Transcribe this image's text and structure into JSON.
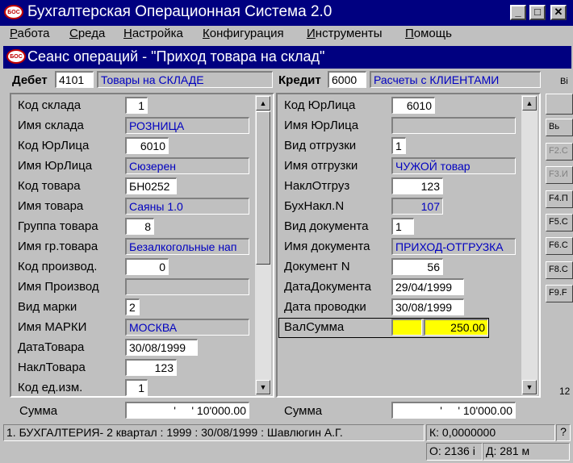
{
  "window": {
    "title": "Бухгалтерская Операционная Система 2.0",
    "controls": {
      "minimize": "_",
      "maximize": "□",
      "close": "✕"
    }
  },
  "menu": [
    "Работа",
    "Среда",
    "Настройка",
    "Конфигурация",
    "Инструменты",
    "Помощь"
  ],
  "session": {
    "title": "Сеанс операций - \"Приход товара на склад\""
  },
  "debit": {
    "label": "Дебет",
    "code": "4101",
    "name": "Товары на СКЛАДЕ"
  },
  "credit": {
    "label": "Кредит",
    "code": "6000",
    "name": "Расчеты с КЛИЕНТАМИ"
  },
  "left_fields": [
    {
      "label": "Код склада",
      "value": "1",
      "kind": "white"
    },
    {
      "label": "Имя склада",
      "value": "РОЗНИЦА",
      "kind": "blue"
    },
    {
      "label": "Код ЮрЛица",
      "value": "6010",
      "kind": "white"
    },
    {
      "label": "Имя ЮрЛица",
      "value": "Сюзерен",
      "kind": "blue"
    },
    {
      "label": "Код товара",
      "value": "БН0252",
      "kind": "white"
    },
    {
      "label": "Имя товара",
      "value": "Саяны 1.0",
      "kind": "blue"
    },
    {
      "label": "Группа товара",
      "value": "8",
      "kind": "white"
    },
    {
      "label": "Имя гр.товара",
      "value": "Безалкогольные нап",
      "kind": "blue"
    },
    {
      "label": "Код производ.",
      "value": "0",
      "kind": "white"
    },
    {
      "label": "Имя Производ",
      "value": "",
      "kind": "blue"
    },
    {
      "label": "Вид марки",
      "value": "2",
      "kind": "white"
    },
    {
      "label": "Имя МАРКИ",
      "value": "МОСКВА",
      "kind": "blue"
    },
    {
      "label": "ДатаТовара",
      "value": "30/08/1999",
      "kind": "white"
    },
    {
      "label": "НаклТовара",
      "value": "123",
      "kind": "white"
    },
    {
      "label": "Код ед.изм.",
      "value": "1",
      "kind": "white"
    }
  ],
  "right_fields": [
    {
      "label": "Код ЮрЛица",
      "value": "6010",
      "kind": "white"
    },
    {
      "label": "Имя ЮрЛица",
      "value": "",
      "kind": "blue"
    },
    {
      "label": "Вид отгрузки",
      "value": "1",
      "kind": "white"
    },
    {
      "label": "Имя отгрузки",
      "value": "ЧУЖОЙ товар",
      "kind": "blue"
    },
    {
      "label": "НаклОтгруз",
      "value": "123",
      "kind": "white"
    },
    {
      "label": "БухНакл.N",
      "value": "107",
      "kind": "blue"
    },
    {
      "label": "Вид документа",
      "value": "1",
      "kind": "white"
    },
    {
      "label": "Имя документа",
      "value": "ПРИХОД-ОТГРУЗКА",
      "kind": "blue"
    },
    {
      "label": "Документ N",
      "value": "56",
      "kind": "white"
    },
    {
      "label": "ДатаДокумента",
      "value": "29/04/1999",
      "kind": "white"
    },
    {
      "label": "Дата проводки",
      "value": "30/08/1999",
      "kind": "white"
    },
    {
      "label": "ВалСумма",
      "value": "250.00",
      "kind": "yellow"
    }
  ],
  "sum_left": {
    "label": "Сумма",
    "value": "'     ' 10'000.00"
  },
  "sum_right": {
    "label": "Сумма",
    "value": "'     ' 10'000.00"
  },
  "side_buttons": [
    "Ві",
    "",
    "Вь",
    "F2.С",
    "F3.И",
    "F4.П",
    "F5.С",
    "F6.С",
    "F8.С",
    "F9.F"
  ],
  "side_number": "12",
  "status": {
    "left": "1. БУХГАЛТЕРИЯ- 2 квартал : 1999 : 30/08/1999 : Шавлюгин А.Г.",
    "k": "К: 0,0000000",
    "help": "?",
    "o": "О:  2136 і",
    "d": "Д:  281 м"
  },
  "colors": {
    "titlebar": "#000080",
    "window": "#c0c0c0",
    "field_text_blue": "#0000c0",
    "highlight": "#ffff00"
  }
}
